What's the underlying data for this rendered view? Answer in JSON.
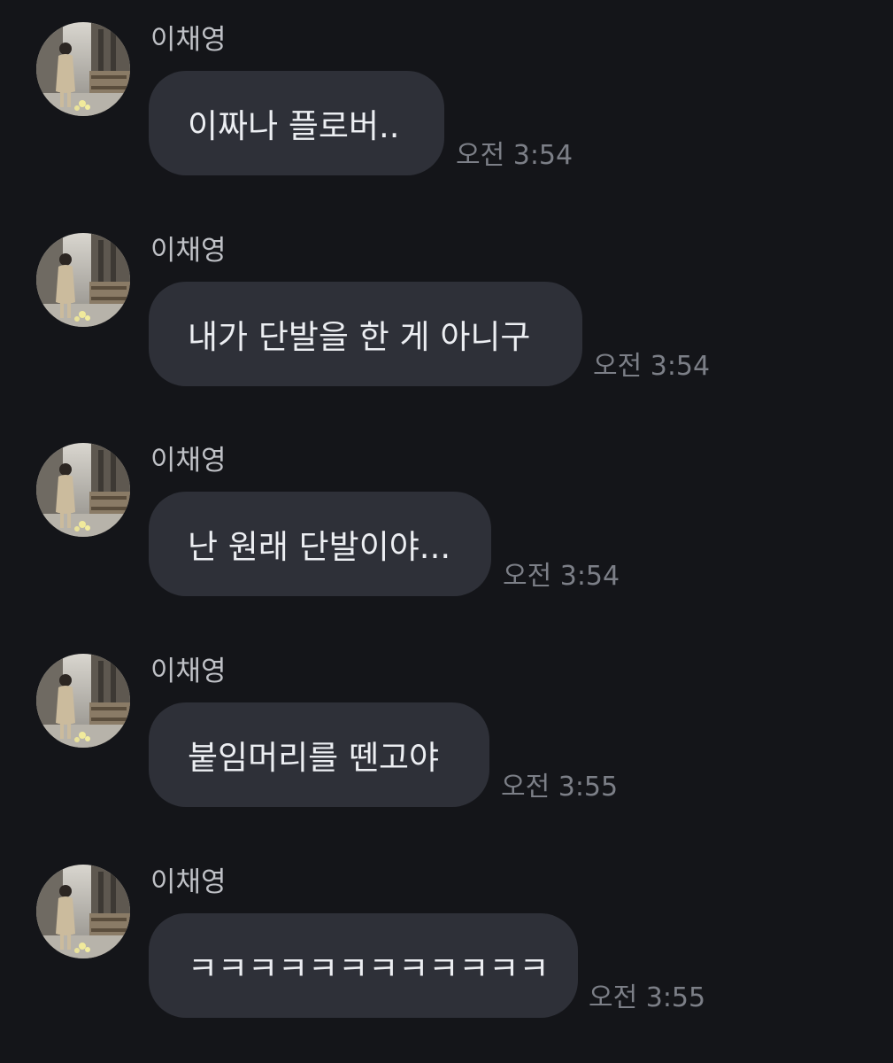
{
  "messages": [
    {
      "sender": "이채영",
      "text": "이짜나 플로버..",
      "time": "오전 3:54"
    },
    {
      "sender": "이채영",
      "text": "내가 단발을 한 게 아니구",
      "time": "오전 3:54"
    },
    {
      "sender": "이채영",
      "text": "난 원래 단발이야...",
      "time": "오전 3:54"
    },
    {
      "sender": "이채영",
      "text": "붙임머리를 뗀고야",
      "time": "오전 3:55"
    },
    {
      "sender": "이채영",
      "text": "ㅋㅋㅋㅋㅋㅋㅋㅋㅋㅋㅋㅋ",
      "time": "오전 3:55"
    }
  ],
  "colors": {
    "background": "#141519",
    "bubble": "#2e3038",
    "message_text": "#eceef2",
    "sender_text": "#bfc1c6",
    "time_text": "#7c7f87"
  },
  "icons": {
    "avatar": "profile-photo"
  }
}
